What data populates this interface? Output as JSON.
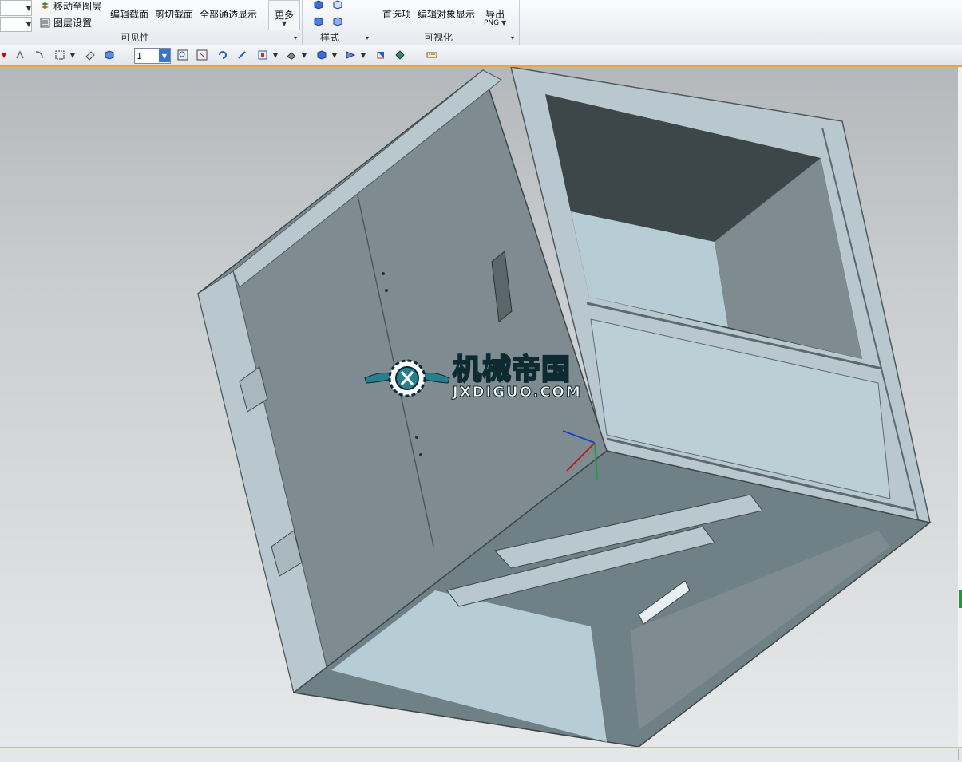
{
  "ribbon": {
    "visibility_group": {
      "caption": "可见性",
      "move_to_layer": "移动至图层",
      "layer_settings": "图层设置",
      "edit_section": "编辑截面",
      "clip_section": "剪切截面",
      "show_all_transparent": "全部通透显示",
      "more": "更多"
    },
    "style_group": {
      "caption": "样式"
    },
    "visualization_group": {
      "caption": "可视化",
      "preferences": "首选项",
      "edit_object_display": "编辑对象显示",
      "export_label": "导出",
      "export_format": "PNG"
    }
  },
  "toolbar": {
    "layer_value": "1"
  },
  "watermark": {
    "brand_cn": "机械帝国",
    "brand_en": "JXDIGUO.COM"
  },
  "colors": {
    "frame_light": "#b9c8cf",
    "frame_dark": "#6f8087",
    "panel_face": "#7e8b90",
    "interior_dark": "#3d4749",
    "interior_light": "#b6cdd5",
    "accent_orange": "#f0a040"
  }
}
